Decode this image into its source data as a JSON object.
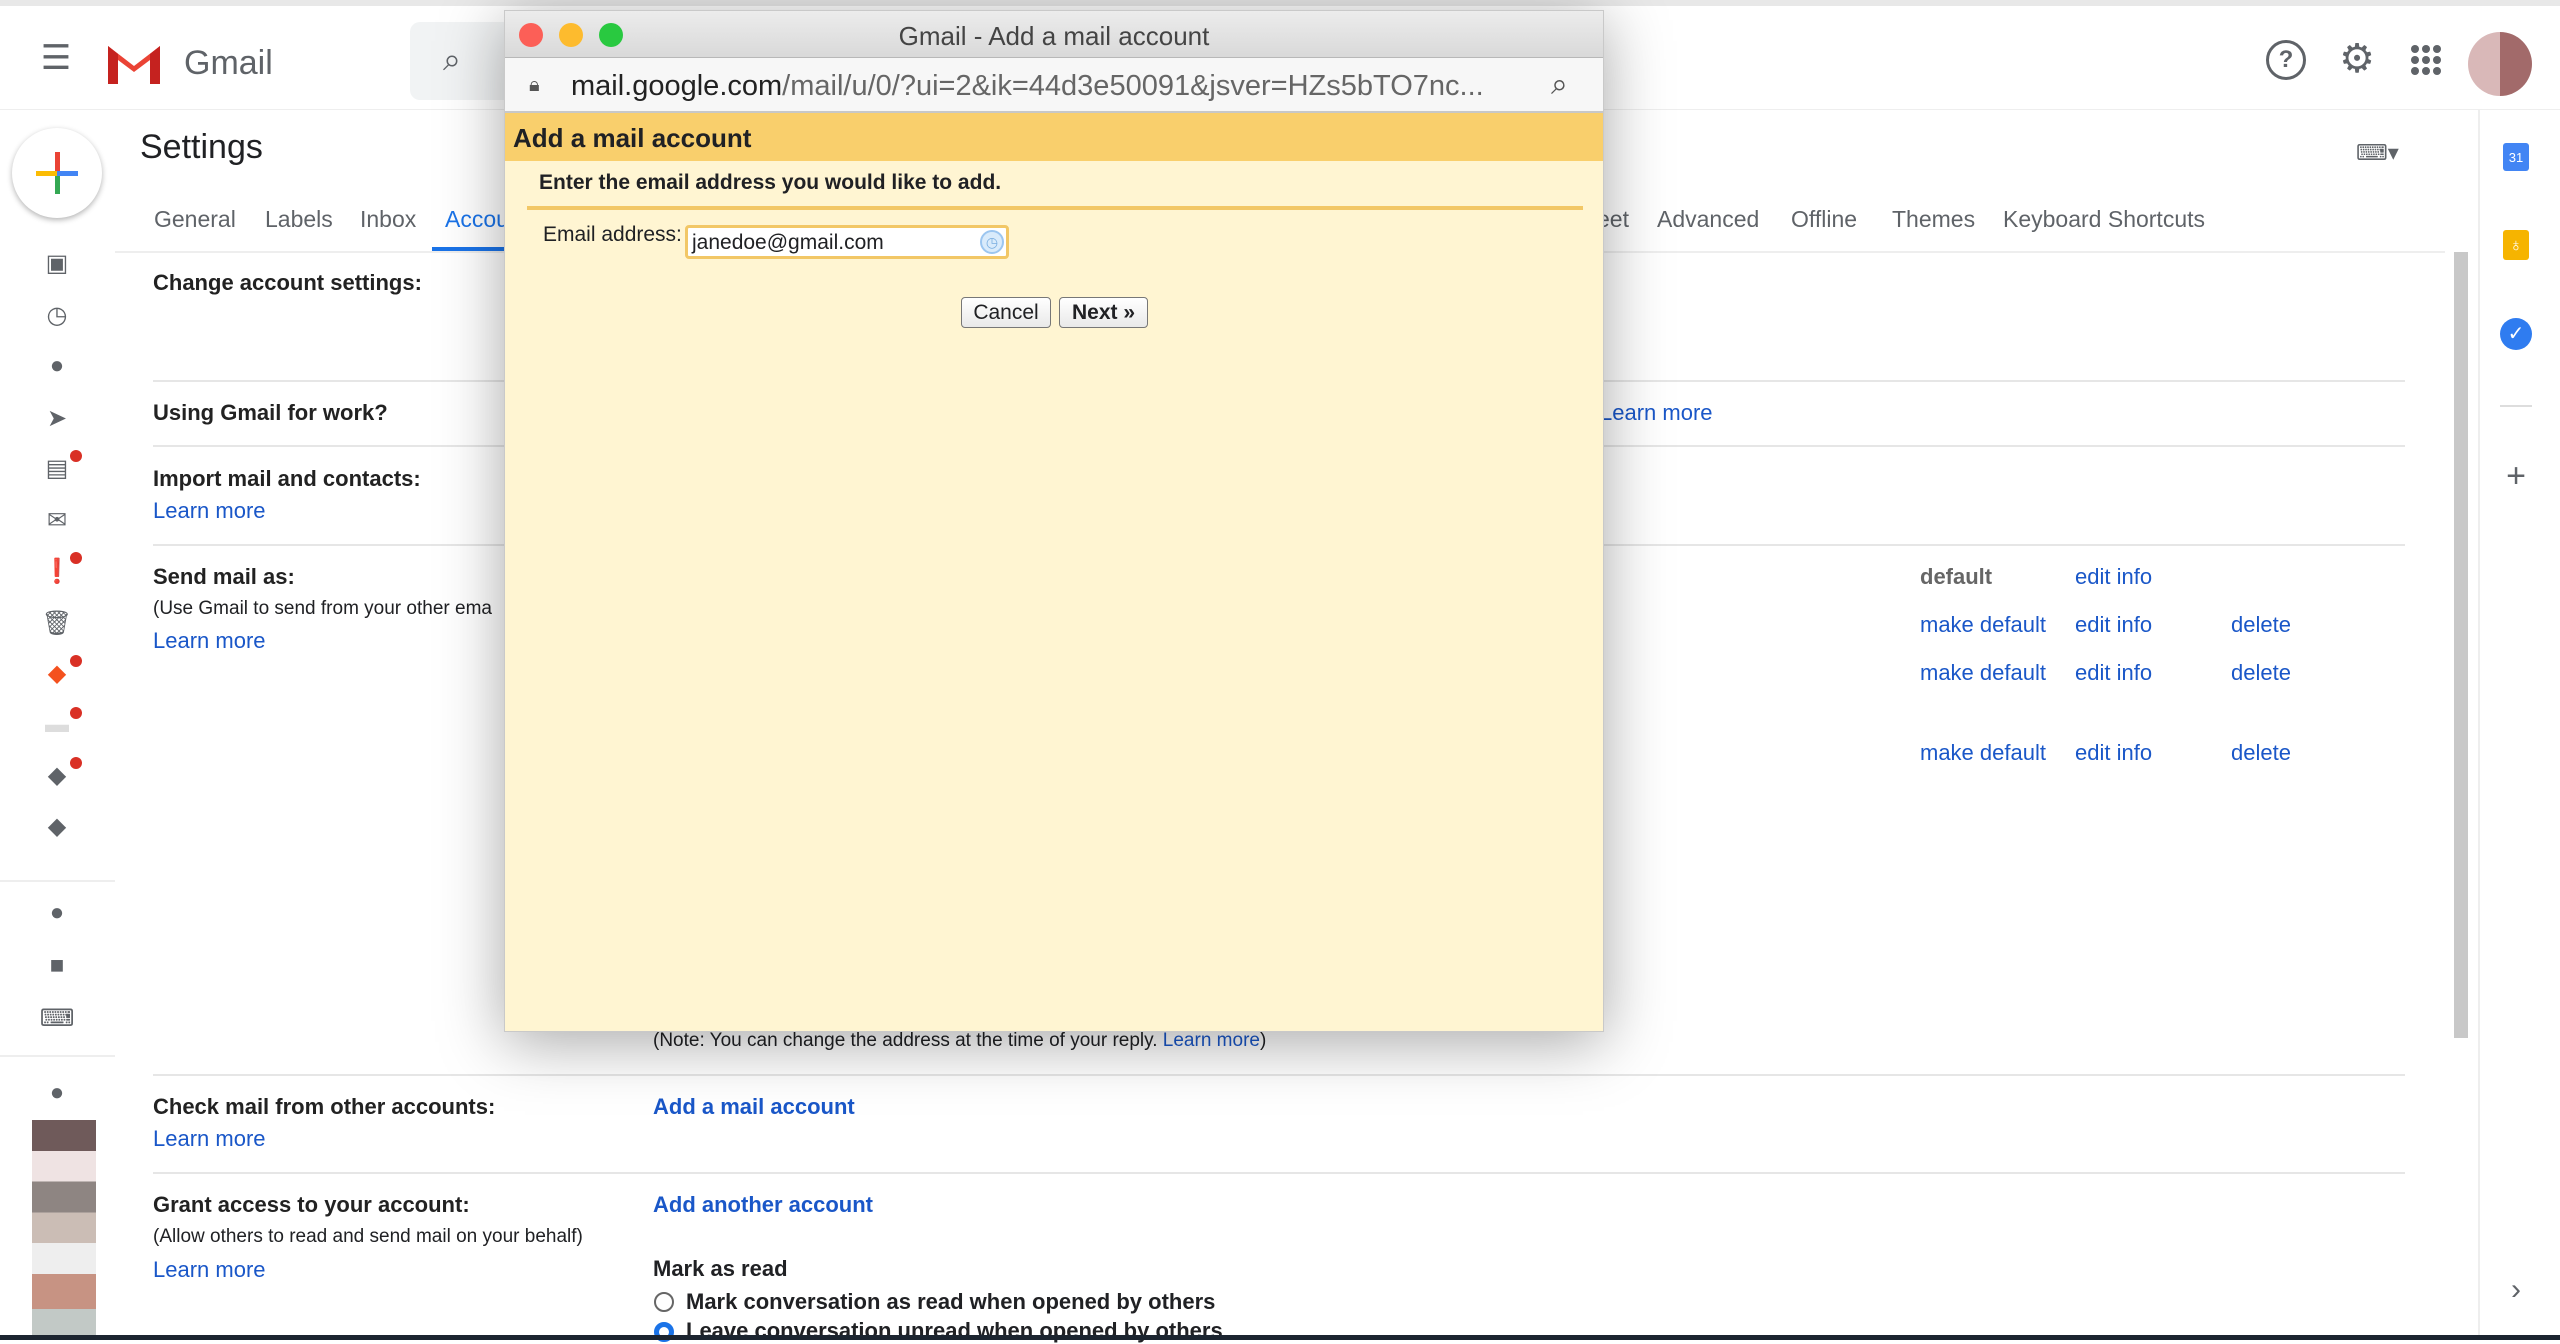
{
  "app": {
    "name": "Gmail",
    "page_title": "Settings"
  },
  "tabs": [
    {
      "label": "General"
    },
    {
      "label": "Labels"
    },
    {
      "label": "Inbox"
    },
    {
      "label": "Accounts",
      "selected": true
    },
    {
      "label": "eet"
    },
    {
      "label": "Advanced"
    },
    {
      "label": "Offline"
    },
    {
      "label": "Themes"
    },
    {
      "label": "Keyboard Shortcuts"
    }
  ],
  "sections": {
    "change_account": "Change account settings:",
    "gmail_work": "Using Gmail for work?",
    "gmail_work_link": "Learn more",
    "import": "Import mail and contacts:",
    "import_link": "Learn more",
    "send_as": "Send mail as:",
    "send_as_desc": "(Use Gmail to send from your other ema",
    "send_as_link": "Learn more",
    "send_as_rows": [
      {
        "default": "default",
        "edit": "edit info"
      },
      {
        "default": "make default",
        "edit": "edit info",
        "delete": "delete"
      },
      {
        "default": "make default",
        "edit": "edit info",
        "delete": "delete"
      },
      {
        "default": "make default",
        "edit": "edit info",
        "delete": "delete"
      }
    ],
    "note": "(Note: You can change the address at the time of your reply. ",
    "note_link": "Learn more",
    "note_end": ")",
    "check_mail": "Check mail from other accounts:",
    "check_mail_link": "Learn more",
    "add_mail_account": "Add a mail account",
    "grant": "Grant access to your account:",
    "grant_desc": "(Allow others to read and send mail on your behalf)",
    "grant_link": "Learn more",
    "add_another": "Add another account",
    "mark_as_read": "Mark as read",
    "radio1": "Mark conversation as read when opened by others",
    "radio2": "Leave conversation unread when opened by others"
  },
  "popup": {
    "window_title": "Gmail - Add a mail account",
    "url_domain": "mail.google.com",
    "url_path": "/mail/u/0/?ui=2&ik=44d3e50091&jsver=HZs5bTO7nc...",
    "heading": "Add a mail account",
    "instruction": "Enter the email address you would like to add.",
    "email_label": "Email address:",
    "email_value": "janedoe@gmail.com",
    "cancel": "Cancel",
    "next": "Next »"
  },
  "colors": {
    "accent": "#1a73e8",
    "link": "#1a57c8",
    "popup_header": "#f9cf6c",
    "popup_body": "#fff5d2"
  }
}
